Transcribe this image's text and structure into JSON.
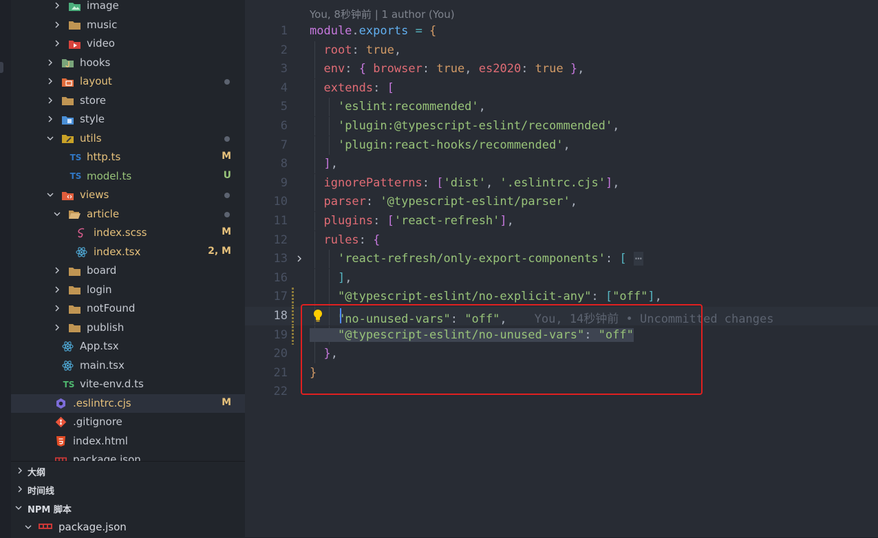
{
  "explorer": {
    "items": [
      {
        "label": "image",
        "indent": 2,
        "expanded": false,
        "icon": "image-folder-icon",
        "status": ""
      },
      {
        "label": "music",
        "indent": 2,
        "expanded": false,
        "icon": "folder-icon",
        "status": ""
      },
      {
        "label": "video",
        "indent": 2,
        "expanded": false,
        "icon": "video-folder-icon",
        "status": ""
      },
      {
        "label": "hooks",
        "indent": 1,
        "expanded": false,
        "icon": "hooks-folder-icon",
        "status": ""
      },
      {
        "label": "layout",
        "indent": 1,
        "expanded": false,
        "icon": "layout-folder-icon",
        "status": "dot"
      },
      {
        "label": "store",
        "indent": 1,
        "expanded": false,
        "icon": "folder-icon",
        "status": ""
      },
      {
        "label": "style",
        "indent": 1,
        "expanded": false,
        "icon": "style-folder-icon",
        "status": ""
      },
      {
        "label": "utils",
        "indent": 1,
        "expanded": true,
        "icon": "utils-folder-icon",
        "status": "dot"
      },
      {
        "label": "http.ts",
        "indent": 2,
        "file": true,
        "icon": "typescript-icon",
        "status": "M"
      },
      {
        "label": "model.ts",
        "indent": 2,
        "file": true,
        "icon": "typescript-icon",
        "status": "U"
      },
      {
        "label": "views",
        "indent": 1,
        "expanded": true,
        "icon": "views-folder-icon",
        "status": "dot"
      },
      {
        "label": "article",
        "indent": 2,
        "expanded": true,
        "icon": "folder-open-icon",
        "status": "dot"
      },
      {
        "label": "index.scss",
        "indent": 3,
        "file": true,
        "icon": "sass-icon",
        "status": "M"
      },
      {
        "label": "index.tsx",
        "indent": 3,
        "file": true,
        "icon": "react-icon",
        "status": "2, M"
      },
      {
        "label": "board",
        "indent": 2,
        "expanded": false,
        "icon": "folder-icon",
        "status": ""
      },
      {
        "label": "login",
        "indent": 2,
        "expanded": false,
        "icon": "folder-icon",
        "status": ""
      },
      {
        "label": "notFound",
        "indent": 2,
        "expanded": false,
        "icon": "folder-icon",
        "status": ""
      },
      {
        "label": "publish",
        "indent": 2,
        "expanded": false,
        "icon": "folder-icon",
        "status": ""
      },
      {
        "label": "App.tsx",
        "indent": 1,
        "file": true,
        "icon": "react-icon",
        "status": ""
      },
      {
        "label": "main.tsx",
        "indent": 1,
        "file": true,
        "icon": "react-icon",
        "status": ""
      },
      {
        "label": "vite-env.d.ts",
        "indent": 1,
        "file": true,
        "icon": "typescript-green-icon",
        "status": ""
      },
      {
        "label": ".eslintrc.cjs",
        "indent": 0,
        "file": true,
        "icon": "eslint-icon",
        "status": "M",
        "selected": true
      },
      {
        "label": ".gitignore",
        "indent": 0,
        "file": true,
        "icon": "git-icon",
        "status": ""
      },
      {
        "label": "index.html",
        "indent": 0,
        "file": true,
        "icon": "html5-icon",
        "status": ""
      },
      {
        "label": "package.json",
        "indent": 0,
        "file": true,
        "icon": "npm-icon",
        "status": ""
      }
    ],
    "ts_glyph": "TS"
  },
  "panels": {
    "outline": "大纲",
    "timeline": "时间线",
    "npm_scripts": "NPM 脚本",
    "npm_package": "package.json"
  },
  "editor": {
    "blame_header": "You, 8秒钟前 | 1 author (You)",
    "inline_blame": "You, 14秒钟前 • Uncommitted changes",
    "current_line": 18,
    "lines": [
      {
        "n": "1"
      },
      {
        "n": "2"
      },
      {
        "n": "3"
      },
      {
        "n": "4"
      },
      {
        "n": "5"
      },
      {
        "n": "6"
      },
      {
        "n": "7"
      },
      {
        "n": "8"
      },
      {
        "n": "9"
      },
      {
        "n": "10"
      },
      {
        "n": "11"
      },
      {
        "n": "12"
      },
      {
        "n": "13"
      },
      {
        "n": "16"
      },
      {
        "n": "17"
      },
      {
        "n": "18"
      },
      {
        "n": "19"
      },
      {
        "n": "20"
      },
      {
        "n": "21"
      },
      {
        "n": "22"
      }
    ],
    "tokens": {
      "l1": [
        "module",
        ".",
        "exports",
        " = ",
        "{"
      ],
      "l2": [
        "root",
        ": ",
        "true",
        ","
      ],
      "l3": [
        "env",
        ": ",
        "{",
        " ",
        "browser",
        ": ",
        "true",
        ", ",
        "es2020",
        ": ",
        "true",
        " ",
        "}",
        ","
      ],
      "l4": [
        "extends",
        ": ",
        "["
      ],
      "l5": [
        "'eslint:recommended'",
        ","
      ],
      "l6": [
        "'plugin:@typescript-eslint/recommended'",
        ","
      ],
      "l7": [
        "'plugin:react-hooks/recommended'",
        ","
      ],
      "l8": [
        "]",
        ","
      ],
      "l9": [
        "ignorePatterns",
        ": ",
        "[",
        "'dist'",
        ", ",
        "'.eslintrc.cjs'",
        "]",
        ","
      ],
      "l10": [
        "parser",
        ": ",
        "'@typescript-eslint/parser'",
        ","
      ],
      "l11": [
        "plugins",
        ": ",
        "[",
        "'react-refresh'",
        "]",
        ","
      ],
      "l12": [
        "rules",
        ": ",
        "{"
      ],
      "l13": [
        "'react-refresh/only-export-components'",
        ": ",
        "[",
        "⋯"
      ],
      "l16": [
        "]",
        ","
      ],
      "l17": [
        "\"@typescript-eslint/no-explicit-any\"",
        ": ",
        "[",
        "\"off\"",
        "]",
        ","
      ],
      "l18": [
        "\"no-unused-vars\"",
        ": ",
        "\"off\"",
        ","
      ],
      "l19": [
        "\"@typescript-eslint/no-unused-vars\"",
        ": ",
        "\"off\""
      ],
      "l20": [
        "}",
        ","
      ],
      "l21": [
        "}"
      ]
    }
  }
}
